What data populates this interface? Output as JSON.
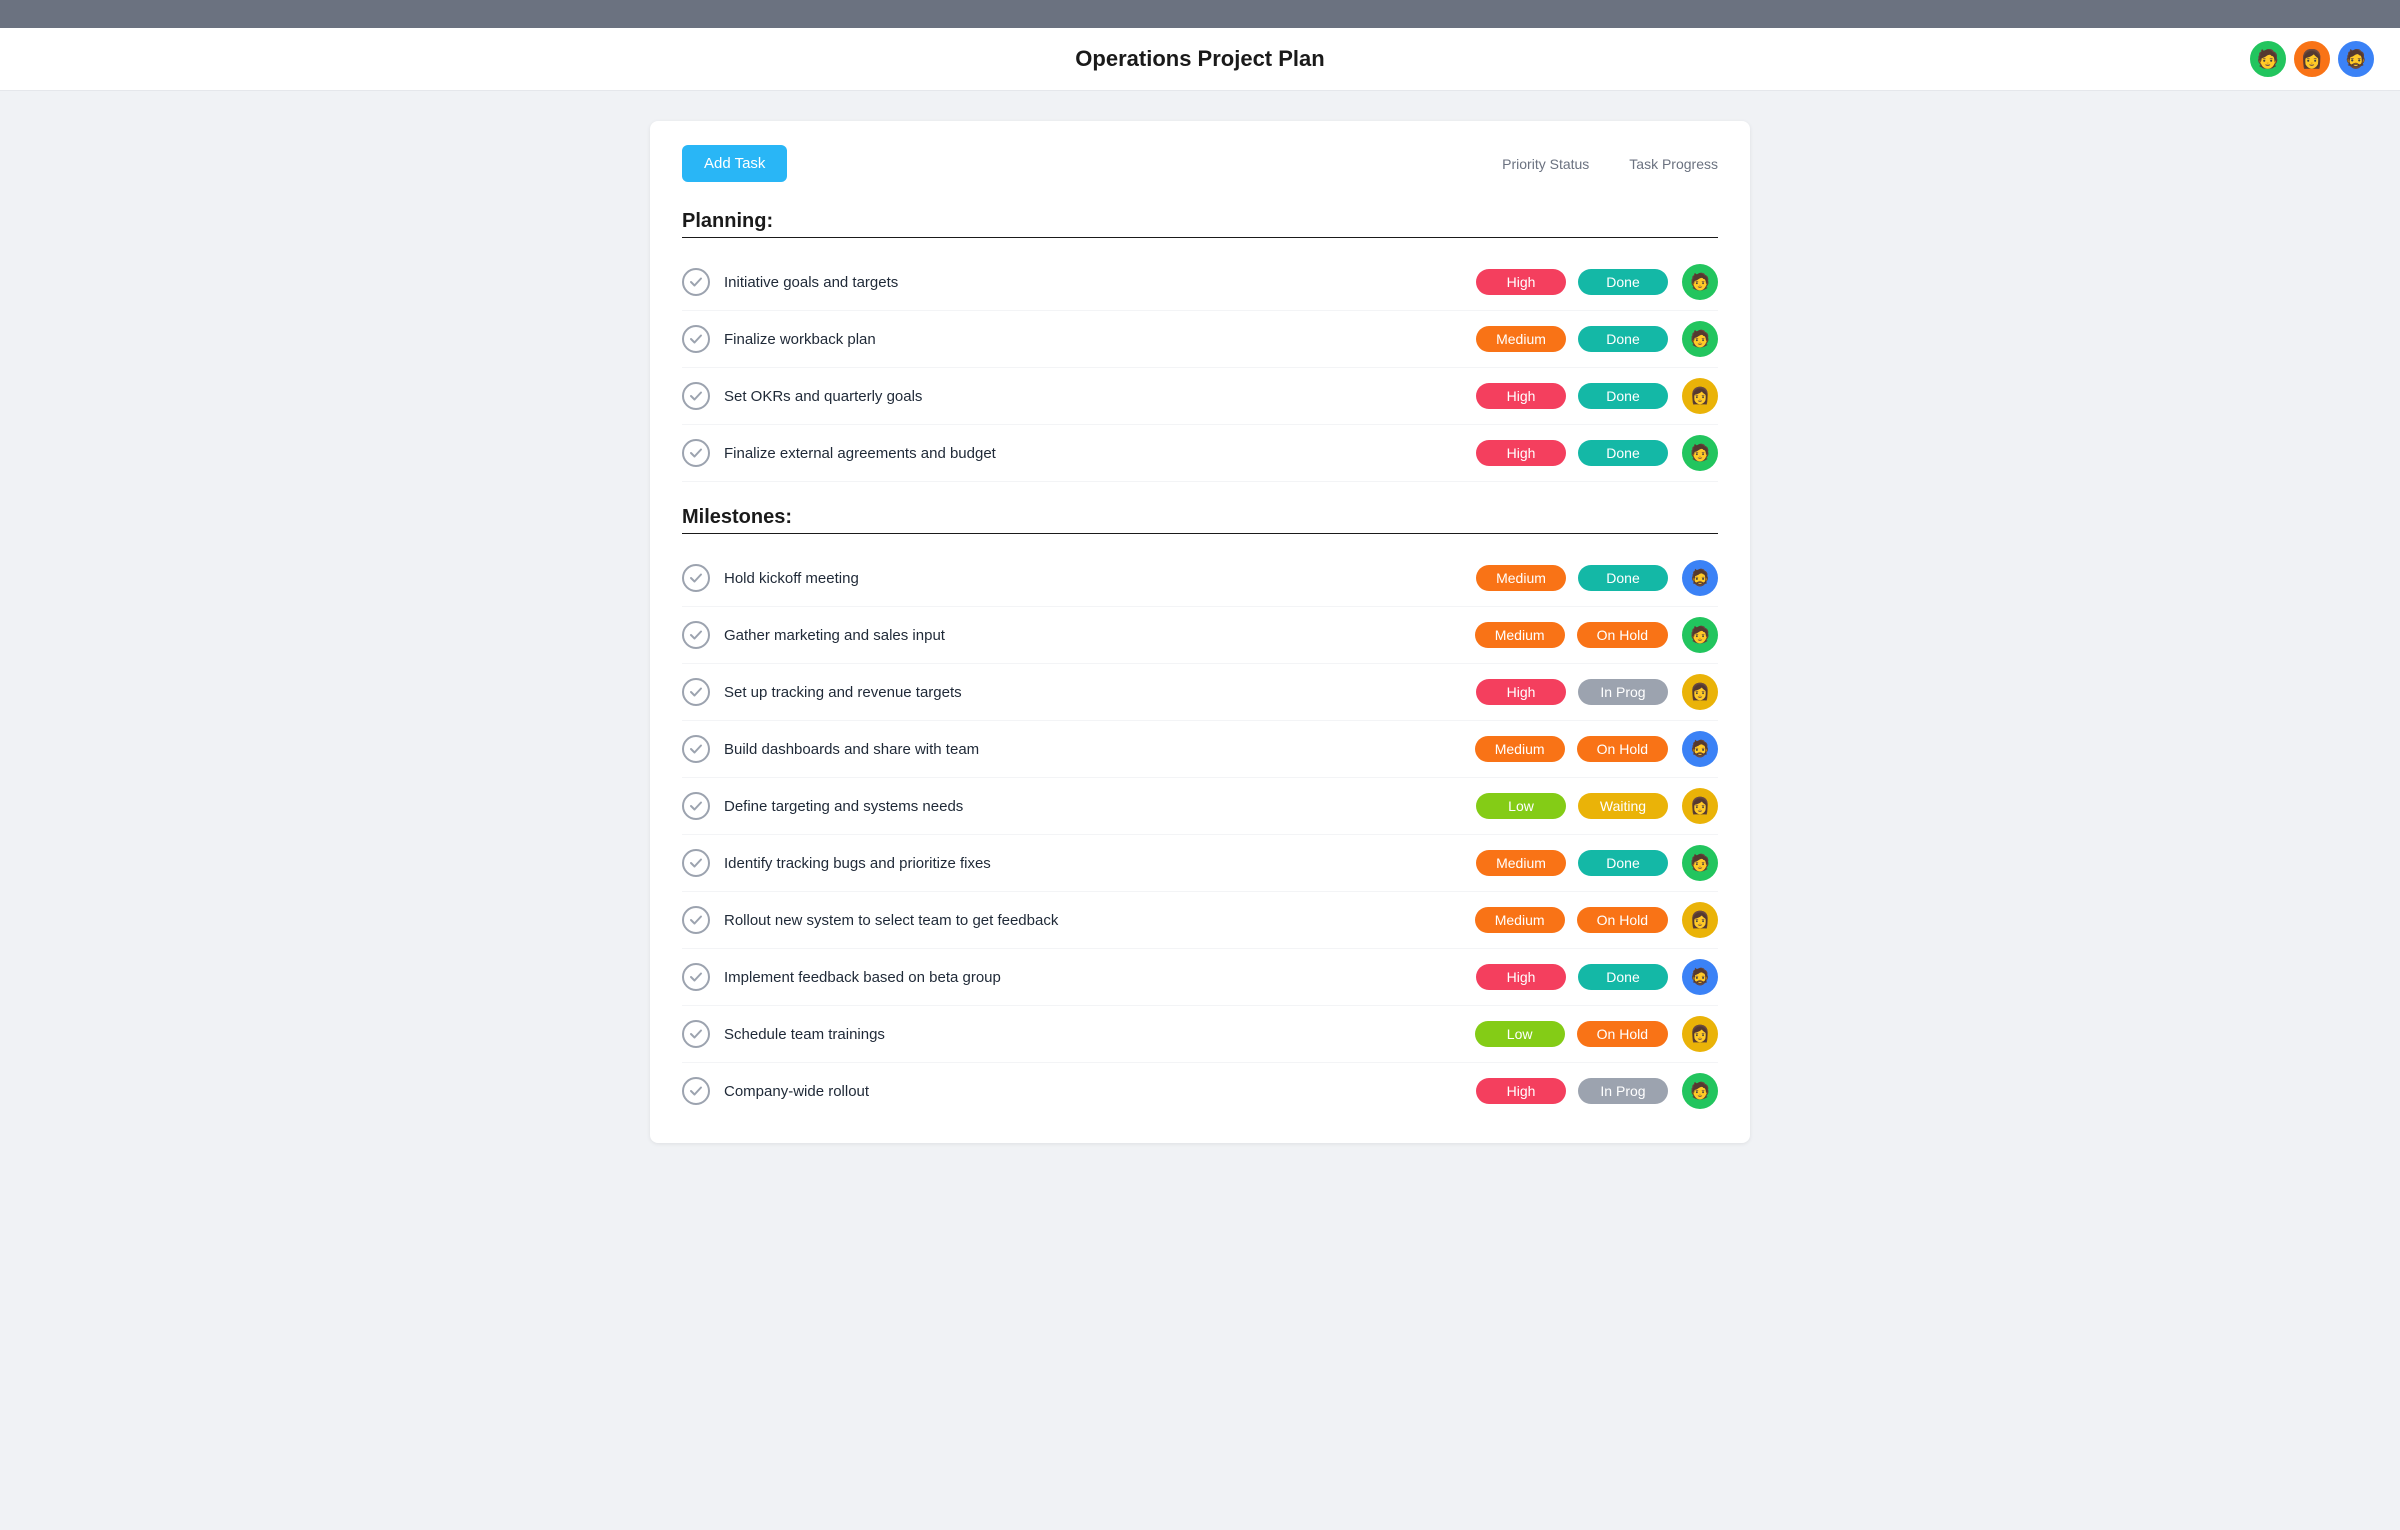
{
  "topBar": {},
  "header": {
    "title": "Operations Project Plan",
    "avatars": [
      {
        "color": "av-green",
        "emoji": "🧑"
      },
      {
        "color": "av-orange",
        "emoji": "👩"
      },
      {
        "color": "av-blue",
        "emoji": "🧔"
      }
    ]
  },
  "toolbar": {
    "addTaskLabel": "Add Task",
    "col1": "Priority Status",
    "col2": "Task Progress"
  },
  "sections": [
    {
      "title": "Planning:",
      "tasks": [
        {
          "name": "Initiative goals and targets",
          "priority": "High",
          "priorityClass": "badge-high",
          "status": "Done",
          "statusClass": "badge-done",
          "avatarClass": "av-green",
          "emoji": "🧑"
        },
        {
          "name": "Finalize workback plan",
          "priority": "Medium",
          "priorityClass": "badge-medium",
          "status": "Done",
          "statusClass": "badge-done",
          "avatarClass": "av-green",
          "emoji": "🧑"
        },
        {
          "name": "Set OKRs and quarterly goals",
          "priority": "High",
          "priorityClass": "badge-high",
          "status": "Done",
          "statusClass": "badge-done",
          "avatarClass": "av-yellow",
          "emoji": "👩"
        },
        {
          "name": "Finalize external agreements and budget",
          "priority": "High",
          "priorityClass": "badge-high",
          "status": "Done",
          "statusClass": "badge-done",
          "avatarClass": "av-green",
          "emoji": "🧑"
        }
      ]
    },
    {
      "title": "Milestones:",
      "tasks": [
        {
          "name": "Hold kickoff meeting",
          "priority": "Medium",
          "priorityClass": "badge-medium",
          "status": "Done",
          "statusClass": "badge-done",
          "avatarClass": "av-blue",
          "emoji": "🧔"
        },
        {
          "name": "Gather marketing and sales input",
          "priority": "Medium",
          "priorityClass": "badge-medium",
          "status": "On Hold",
          "statusClass": "badge-on-hold",
          "avatarClass": "av-green",
          "emoji": "🧑"
        },
        {
          "name": "Set up tracking and revenue targets",
          "priority": "High",
          "priorityClass": "badge-high",
          "status": "In Prog",
          "statusClass": "badge-in-prog",
          "avatarClass": "av-yellow",
          "emoji": "👩"
        },
        {
          "name": "Build dashboards and share with team",
          "priority": "Medium",
          "priorityClass": "badge-medium",
          "status": "On Hold",
          "statusClass": "badge-on-hold",
          "avatarClass": "av-blue",
          "emoji": "🧔"
        },
        {
          "name": "Define targeting and systems needs",
          "priority": "Low",
          "priorityClass": "badge-low",
          "status": "Waiting",
          "statusClass": "badge-waiting",
          "avatarClass": "av-yellow",
          "emoji": "👩"
        },
        {
          "name": "Identify tracking bugs and prioritize fixes",
          "priority": "Medium",
          "priorityClass": "badge-medium",
          "status": "Done",
          "statusClass": "badge-done",
          "avatarClass": "av-green",
          "emoji": "🧑"
        },
        {
          "name": "Rollout new system to select team to get feedback",
          "priority": "Medium",
          "priorityClass": "badge-medium",
          "status": "On Hold",
          "statusClass": "badge-on-hold",
          "avatarClass": "av-yellow",
          "emoji": "👩"
        },
        {
          "name": "Implement feedback based on beta group",
          "priority": "High",
          "priorityClass": "badge-high",
          "status": "Done",
          "statusClass": "badge-done",
          "avatarClass": "av-blue",
          "emoji": "🧔"
        },
        {
          "name": "Schedule team trainings",
          "priority": "Low",
          "priorityClass": "badge-low",
          "status": "On Hold",
          "statusClass": "badge-on-hold",
          "avatarClass": "av-yellow",
          "emoji": "👩"
        },
        {
          "name": "Company-wide rollout",
          "priority": "High",
          "priorityClass": "badge-high",
          "status": "In Prog",
          "statusClass": "badge-in-prog",
          "avatarClass": "av-green",
          "emoji": "🧑"
        }
      ]
    }
  ]
}
